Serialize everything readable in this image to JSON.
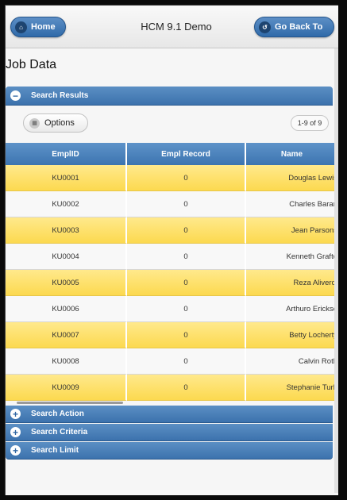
{
  "header": {
    "home_label": "Home",
    "title": "HCM 9.1 Demo",
    "back_label": "Go Back To"
  },
  "page_title": "Job Data",
  "search_results": {
    "label": "Search Results",
    "options_label": "Options",
    "count": "1-9 of 9"
  },
  "table": {
    "columns": [
      "EmplID",
      "Empl Record",
      "Name"
    ],
    "rows": [
      {
        "id": "KU0001",
        "rec": "0",
        "name": "Douglas Lewis"
      },
      {
        "id": "KU0002",
        "rec": "0",
        "name": "Charles Baran"
      },
      {
        "id": "KU0003",
        "rec": "0",
        "name": "Jean Parsons"
      },
      {
        "id": "KU0004",
        "rec": "0",
        "name": "Kenneth Grafto"
      },
      {
        "id": "KU0005",
        "rec": "0",
        "name": "Reza Aliverdi"
      },
      {
        "id": "KU0006",
        "rec": "0",
        "name": "Arthuro Erickso"
      },
      {
        "id": "KU0007",
        "rec": "0",
        "name": "Betty Locherty"
      },
      {
        "id": "KU0008",
        "rec": "0",
        "name": "Calvin Roth"
      },
      {
        "id": "KU0009",
        "rec": "0",
        "name": "Stephanie Turb"
      }
    ]
  },
  "sections": {
    "search_action": "Search Action",
    "search_criteria": "Search Criteria",
    "search_limit": "Search Limit"
  },
  "colors": {
    "accent_blue": "#3c72ad",
    "row_highlight": "#fcd94f"
  }
}
